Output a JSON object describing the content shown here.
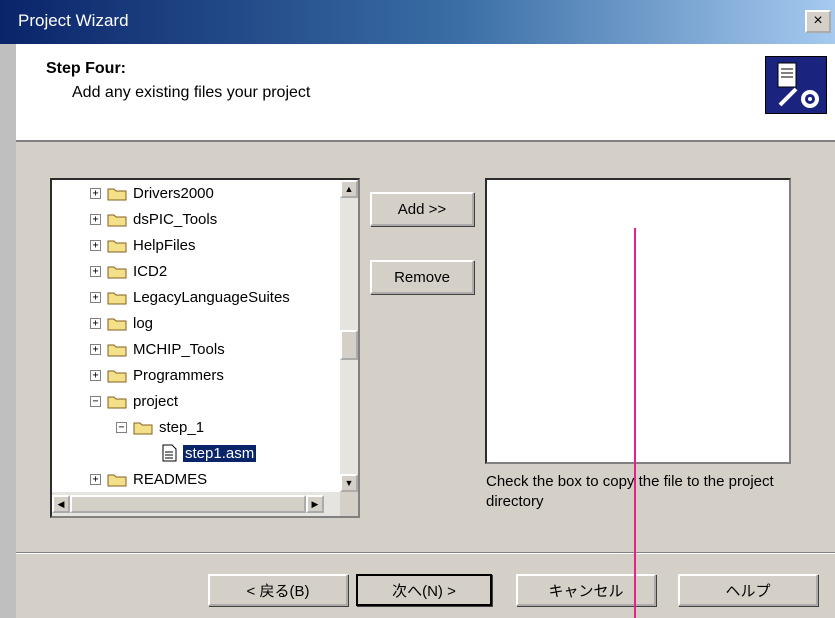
{
  "window": {
    "title": "Project Wizard",
    "close_glyph": "×"
  },
  "header": {
    "step_title": "Step Four:",
    "step_subtitle": "Add any existing files your project",
    "icon": "wizard-tools-icon"
  },
  "tree": {
    "items": [
      {
        "label": "Drivers2000",
        "expander": "+",
        "level": 0,
        "type": "folder"
      },
      {
        "label": "dsPIC_Tools",
        "expander": "+",
        "level": 0,
        "type": "folder"
      },
      {
        "label": "HelpFiles",
        "expander": "+",
        "level": 0,
        "type": "folder"
      },
      {
        "label": "ICD2",
        "expander": "+",
        "level": 0,
        "type": "folder"
      },
      {
        "label": "LegacyLanguageSuites",
        "expander": "+",
        "level": 0,
        "type": "folder"
      },
      {
        "label": "log",
        "expander": "+",
        "level": 0,
        "type": "folder"
      },
      {
        "label": "MCHIP_Tools",
        "expander": "+",
        "level": 0,
        "type": "folder"
      },
      {
        "label": "Programmers",
        "expander": "+",
        "level": 0,
        "type": "folder"
      },
      {
        "label": "project",
        "expander": "−",
        "level": 0,
        "type": "folder"
      },
      {
        "label": "step_1",
        "expander": "−",
        "level": 1,
        "type": "folder"
      },
      {
        "label": "step1.asm",
        "expander": "",
        "level": 2,
        "type": "file",
        "selected": true
      },
      {
        "label": "READMES",
        "expander": "+",
        "level": 0,
        "type": "folder"
      }
    ]
  },
  "actions": {
    "add_label": "Add >>",
    "remove_label": "Remove"
  },
  "file_list": {
    "hint": "Check the box to copy the file to the project directory"
  },
  "footer": {
    "back_label": "< 戻る(B)",
    "next_label": "次へ(N) >",
    "cancel_label": "キャンセル",
    "help_label": "ヘルプ"
  },
  "colors": {
    "title_bar": "#0a246a",
    "selection": "#0a246a",
    "annotation_line": "#e8208c"
  }
}
